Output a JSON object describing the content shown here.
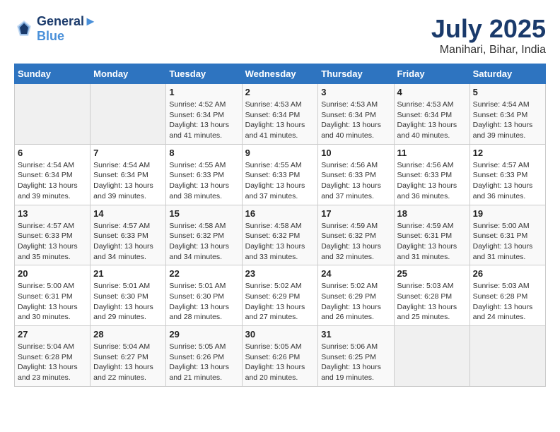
{
  "header": {
    "logo_line1": "General",
    "logo_line2": "Blue",
    "month_year": "July 2025",
    "location": "Manihari, Bihar, India"
  },
  "days_of_week": [
    "Sunday",
    "Monday",
    "Tuesday",
    "Wednesday",
    "Thursday",
    "Friday",
    "Saturday"
  ],
  "weeks": [
    [
      {
        "day": "",
        "sunrise": "",
        "sunset": "",
        "daylight": "",
        "empty": true
      },
      {
        "day": "",
        "sunrise": "",
        "sunset": "",
        "daylight": "",
        "empty": true
      },
      {
        "day": "1",
        "sunrise": "Sunrise: 4:52 AM",
        "sunset": "Sunset: 6:34 PM",
        "daylight": "Daylight: 13 hours and 41 minutes."
      },
      {
        "day": "2",
        "sunrise": "Sunrise: 4:53 AM",
        "sunset": "Sunset: 6:34 PM",
        "daylight": "Daylight: 13 hours and 41 minutes."
      },
      {
        "day": "3",
        "sunrise": "Sunrise: 4:53 AM",
        "sunset": "Sunset: 6:34 PM",
        "daylight": "Daylight: 13 hours and 40 minutes."
      },
      {
        "day": "4",
        "sunrise": "Sunrise: 4:53 AM",
        "sunset": "Sunset: 6:34 PM",
        "daylight": "Daylight: 13 hours and 40 minutes."
      },
      {
        "day": "5",
        "sunrise": "Sunrise: 4:54 AM",
        "sunset": "Sunset: 6:34 PM",
        "daylight": "Daylight: 13 hours and 39 minutes."
      }
    ],
    [
      {
        "day": "6",
        "sunrise": "Sunrise: 4:54 AM",
        "sunset": "Sunset: 6:34 PM",
        "daylight": "Daylight: 13 hours and 39 minutes."
      },
      {
        "day": "7",
        "sunrise": "Sunrise: 4:54 AM",
        "sunset": "Sunset: 6:34 PM",
        "daylight": "Daylight: 13 hours and 39 minutes."
      },
      {
        "day": "8",
        "sunrise": "Sunrise: 4:55 AM",
        "sunset": "Sunset: 6:33 PM",
        "daylight": "Daylight: 13 hours and 38 minutes."
      },
      {
        "day": "9",
        "sunrise": "Sunrise: 4:55 AM",
        "sunset": "Sunset: 6:33 PM",
        "daylight": "Daylight: 13 hours and 37 minutes."
      },
      {
        "day": "10",
        "sunrise": "Sunrise: 4:56 AM",
        "sunset": "Sunset: 6:33 PM",
        "daylight": "Daylight: 13 hours and 37 minutes."
      },
      {
        "day": "11",
        "sunrise": "Sunrise: 4:56 AM",
        "sunset": "Sunset: 6:33 PM",
        "daylight": "Daylight: 13 hours and 36 minutes."
      },
      {
        "day": "12",
        "sunrise": "Sunrise: 4:57 AM",
        "sunset": "Sunset: 6:33 PM",
        "daylight": "Daylight: 13 hours and 36 minutes."
      }
    ],
    [
      {
        "day": "13",
        "sunrise": "Sunrise: 4:57 AM",
        "sunset": "Sunset: 6:33 PM",
        "daylight": "Daylight: 13 hours and 35 minutes."
      },
      {
        "day": "14",
        "sunrise": "Sunrise: 4:57 AM",
        "sunset": "Sunset: 6:33 PM",
        "daylight": "Daylight: 13 hours and 34 minutes."
      },
      {
        "day": "15",
        "sunrise": "Sunrise: 4:58 AM",
        "sunset": "Sunset: 6:32 PM",
        "daylight": "Daylight: 13 hours and 34 minutes."
      },
      {
        "day": "16",
        "sunrise": "Sunrise: 4:58 AM",
        "sunset": "Sunset: 6:32 PM",
        "daylight": "Daylight: 13 hours and 33 minutes."
      },
      {
        "day": "17",
        "sunrise": "Sunrise: 4:59 AM",
        "sunset": "Sunset: 6:32 PM",
        "daylight": "Daylight: 13 hours and 32 minutes."
      },
      {
        "day": "18",
        "sunrise": "Sunrise: 4:59 AM",
        "sunset": "Sunset: 6:31 PM",
        "daylight": "Daylight: 13 hours and 31 minutes."
      },
      {
        "day": "19",
        "sunrise": "Sunrise: 5:00 AM",
        "sunset": "Sunset: 6:31 PM",
        "daylight": "Daylight: 13 hours and 31 minutes."
      }
    ],
    [
      {
        "day": "20",
        "sunrise": "Sunrise: 5:00 AM",
        "sunset": "Sunset: 6:31 PM",
        "daylight": "Daylight: 13 hours and 30 minutes."
      },
      {
        "day": "21",
        "sunrise": "Sunrise: 5:01 AM",
        "sunset": "Sunset: 6:30 PM",
        "daylight": "Daylight: 13 hours and 29 minutes."
      },
      {
        "day": "22",
        "sunrise": "Sunrise: 5:01 AM",
        "sunset": "Sunset: 6:30 PM",
        "daylight": "Daylight: 13 hours and 28 minutes."
      },
      {
        "day": "23",
        "sunrise": "Sunrise: 5:02 AM",
        "sunset": "Sunset: 6:29 PM",
        "daylight": "Daylight: 13 hours and 27 minutes."
      },
      {
        "day": "24",
        "sunrise": "Sunrise: 5:02 AM",
        "sunset": "Sunset: 6:29 PM",
        "daylight": "Daylight: 13 hours and 26 minutes."
      },
      {
        "day": "25",
        "sunrise": "Sunrise: 5:03 AM",
        "sunset": "Sunset: 6:28 PM",
        "daylight": "Daylight: 13 hours and 25 minutes."
      },
      {
        "day": "26",
        "sunrise": "Sunrise: 5:03 AM",
        "sunset": "Sunset: 6:28 PM",
        "daylight": "Daylight: 13 hours and 24 minutes."
      }
    ],
    [
      {
        "day": "27",
        "sunrise": "Sunrise: 5:04 AM",
        "sunset": "Sunset: 6:28 PM",
        "daylight": "Daylight: 13 hours and 23 minutes."
      },
      {
        "day": "28",
        "sunrise": "Sunrise: 5:04 AM",
        "sunset": "Sunset: 6:27 PM",
        "daylight": "Daylight: 13 hours and 22 minutes."
      },
      {
        "day": "29",
        "sunrise": "Sunrise: 5:05 AM",
        "sunset": "Sunset: 6:26 PM",
        "daylight": "Daylight: 13 hours and 21 minutes."
      },
      {
        "day": "30",
        "sunrise": "Sunrise: 5:05 AM",
        "sunset": "Sunset: 6:26 PM",
        "daylight": "Daylight: 13 hours and 20 minutes."
      },
      {
        "day": "31",
        "sunrise": "Sunrise: 5:06 AM",
        "sunset": "Sunset: 6:25 PM",
        "daylight": "Daylight: 13 hours and 19 minutes."
      },
      {
        "day": "",
        "sunrise": "",
        "sunset": "",
        "daylight": "",
        "empty": true
      },
      {
        "day": "",
        "sunrise": "",
        "sunset": "",
        "daylight": "",
        "empty": true
      }
    ]
  ]
}
